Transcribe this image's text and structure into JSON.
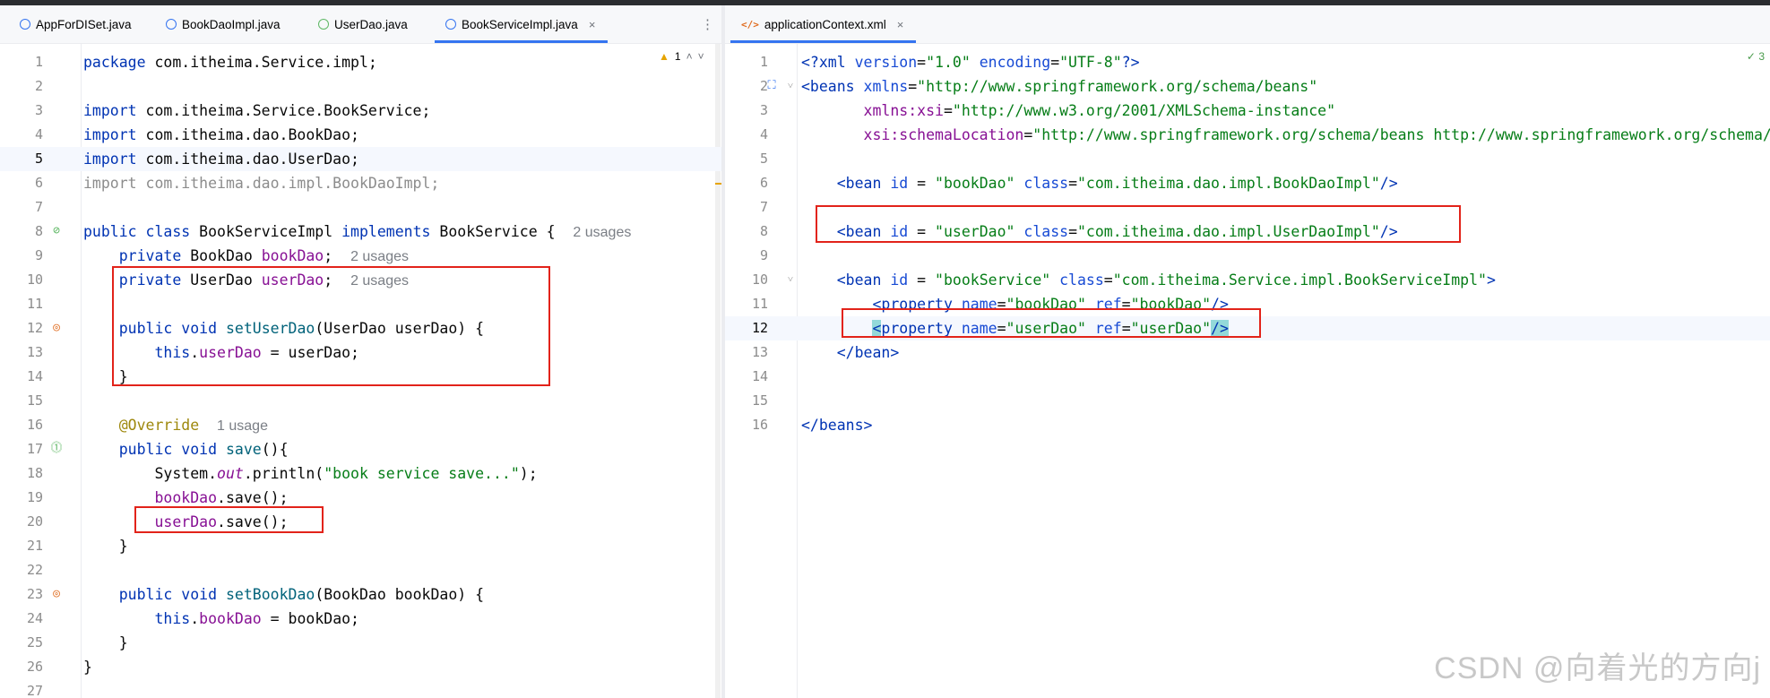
{
  "left_tabs": [
    {
      "label": "AppForDISet.java",
      "icon": "class-icon",
      "active": false
    },
    {
      "label": "BookDaoImpl.java",
      "icon": "class-icon",
      "active": false
    },
    {
      "label": "UserDao.java",
      "icon": "interface-icon",
      "active": false
    },
    {
      "label": "BookServiceImpl.java",
      "icon": "class-icon",
      "active": true
    }
  ],
  "right_tabs": [
    {
      "label": "applicationContext.xml",
      "icon": "xml-icon",
      "active": true
    }
  ],
  "tab_close_glyph": "×",
  "left_editor": {
    "inspection": {
      "count": "1"
    },
    "line_numbers": [
      "1",
      "2",
      "3",
      "4",
      "5",
      "6",
      "7",
      "8",
      "9",
      "10",
      "11",
      "12",
      "13",
      "14",
      "15",
      "16",
      "17",
      "18",
      "19",
      "20",
      "21",
      "22",
      "23",
      "24",
      "25",
      "26",
      "27"
    ],
    "current_line": "5",
    "usages": {
      "class": "2 usages",
      "bookDao_field": "2 usages",
      "userDao_field": "2 usages",
      "save_override": "1 usage"
    }
  },
  "right_editor": {
    "inspection": {
      "count": "3"
    },
    "line_numbers": [
      "1",
      "2",
      "3",
      "4",
      "5",
      "6",
      "7",
      "8",
      "9",
      "10",
      "11",
      "12",
      "13",
      "14",
      "15",
      "16"
    ],
    "current_line": "12"
  },
  "watermark": "CSDN @向着光的方向j",
  "colors": {
    "highlight_box": "#e2231a",
    "tab_accent": "#3574f0",
    "keyword": "#0033b3",
    "string": "#067d17",
    "field": "#871094"
  }
}
